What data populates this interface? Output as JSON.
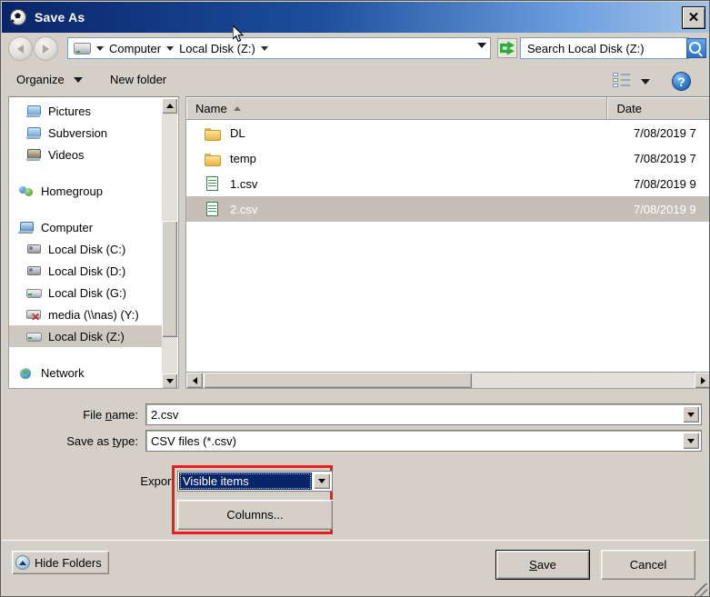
{
  "window": {
    "title": "Save As",
    "icon": "soccer-ball-icon",
    "close_label": "✕"
  },
  "nav": {
    "back_label": "Back",
    "forward_label": "Forward",
    "breadcrumb": [
      "Computer",
      "Local Disk (Z:)"
    ],
    "refresh_label": "Refresh",
    "search_placeholder": "Search Local Disk (Z:)",
    "search_label": "Search"
  },
  "toolbar": {
    "organize_label": "Organize",
    "new_folder_label": "New folder",
    "view_label": "Change your view",
    "help_label": "?"
  },
  "sidebar": {
    "items": [
      {
        "label": "Pictures",
        "icon": "pictures-icon",
        "indent": "child",
        "selected": false
      },
      {
        "label": "Subversion",
        "icon": "subversion-icon",
        "indent": "child",
        "selected": false
      },
      {
        "label": "Videos",
        "icon": "videos-icon",
        "indent": "child",
        "selected": false
      },
      {
        "label": "Homegroup",
        "icon": "homegroup-icon",
        "indent": "root",
        "selected": false
      },
      {
        "label": "Computer",
        "icon": "computer-icon",
        "indent": "root",
        "selected": false
      },
      {
        "label": "Local Disk (C:)",
        "icon": "hard-disk-icon",
        "indent": "child",
        "selected": false
      },
      {
        "label": "Local Disk (D:)",
        "icon": "hard-disk-icon",
        "indent": "child",
        "selected": false
      },
      {
        "label": "Local Disk (G:)",
        "icon": "drive-icon",
        "indent": "child",
        "selected": false
      },
      {
        "label": "media (\\\\nas) (Y:)",
        "icon": "disconnected-network-drive-icon",
        "indent": "child",
        "selected": false
      },
      {
        "label": "Local Disk (Z:)",
        "icon": "drive-icon",
        "indent": "child",
        "selected": true
      },
      {
        "label": "Network",
        "icon": "network-icon",
        "indent": "root",
        "selected": false
      }
    ]
  },
  "filelist": {
    "columns": [
      {
        "key": "name",
        "label": "Name",
        "sorted": "asc"
      },
      {
        "key": "date",
        "label": "Date",
        "sorted": "none"
      }
    ],
    "rows": [
      {
        "name": "DL",
        "date": "7/08/2019 7",
        "icon": "folder-icon",
        "selected": false
      },
      {
        "name": "temp",
        "date": "7/08/2019 7",
        "icon": "folder-icon",
        "selected": false
      },
      {
        "name": "1.csv",
        "date": "7/08/2019 9",
        "icon": "csv-file-icon",
        "selected": false
      },
      {
        "name": "2.csv",
        "date": "7/08/2019 9",
        "icon": "csv-file-icon",
        "selected": true
      }
    ]
  },
  "form": {
    "filename_label_before": "File ",
    "filename_label_accel": "n",
    "filename_label_after": "ame:",
    "filename_value": "2.csv",
    "savetype_label_before": "Save as ",
    "savetype_label_accel": "t",
    "savetype_label_after": "ype:",
    "savetype_value": "CSV files (*.csv)",
    "export_label": "Export",
    "export_value": "Visible items",
    "columns_button_label": "Columns..."
  },
  "footer": {
    "hide_folders_label": "Hide Folders",
    "save_label_before": "",
    "save_label_accel": "S",
    "save_label_after": "ave",
    "cancel_label": "Cancel"
  },
  "colors": {
    "highlight_red": "#ee1c1c",
    "titlebar_dark": "#0a246a",
    "titlebar_light": "#a3c3e8",
    "selection_navy": "#0a246a",
    "row_selected_grey": "#c5c0b7",
    "dialog_face": "#d4d0c8"
  }
}
